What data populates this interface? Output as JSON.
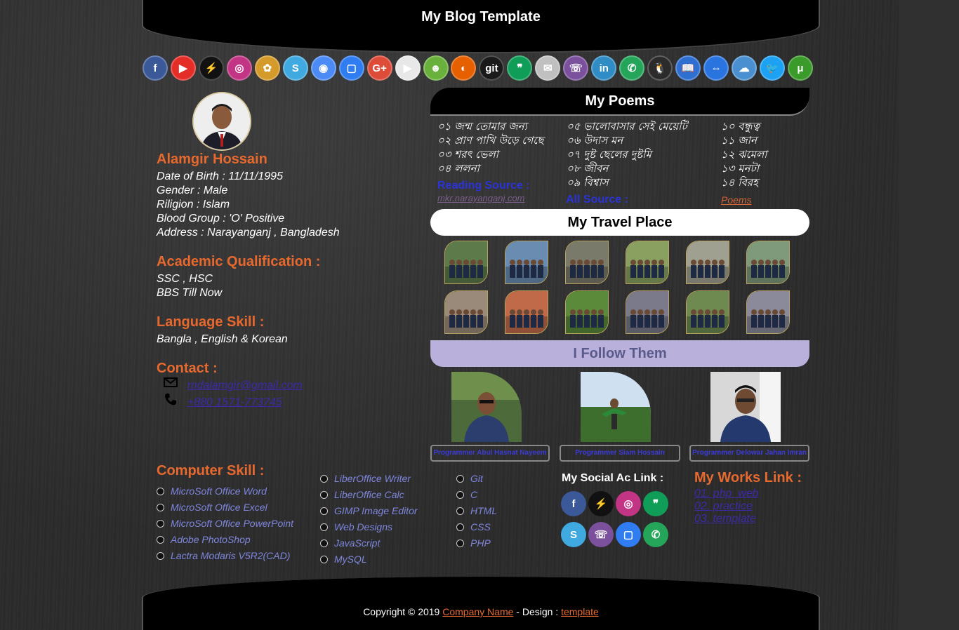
{
  "header": {
    "title": "My Blog Template"
  },
  "iconbar": [
    {
      "name": "facebook-icon",
      "glyph": "f",
      "color": "#3b5998"
    },
    {
      "name": "youtube-icon",
      "glyph": "▶",
      "color": "#e52d27"
    },
    {
      "name": "messenger-icon",
      "glyph": "⚡",
      "color": "#111111"
    },
    {
      "name": "instagram-icon",
      "glyph": "◎",
      "color": "#c13584"
    },
    {
      "name": "picasa-icon",
      "glyph": "✿",
      "color": "#d49a2a"
    },
    {
      "name": "skype-icon",
      "glyph": "S",
      "color": "#3fa9e0"
    },
    {
      "name": "chrome-icon",
      "glyph": "◉",
      "color": "#4c8bf5"
    },
    {
      "name": "duo-icon",
      "glyph": "▢",
      "color": "#2f7df0"
    },
    {
      "name": "google-plus-icon",
      "glyph": "G+",
      "color": "#dd4b39"
    },
    {
      "name": "play-store-icon",
      "glyph": "▶",
      "color": "#e8e8e8"
    },
    {
      "name": "duolingo-icon",
      "glyph": "☻",
      "color": "#6ab03c"
    },
    {
      "name": "firefox-icon",
      "glyph": "◐",
      "color": "#e66000"
    },
    {
      "name": "git-icon",
      "glyph": "git",
      "color": "#1a1a1a"
    },
    {
      "name": "hangouts-icon",
      "glyph": "❞",
      "color": "#0f9d58"
    },
    {
      "name": "gmail-icon",
      "glyph": "✉",
      "color": "#c0c0c0"
    },
    {
      "name": "viber-icon",
      "glyph": "☏",
      "color": "#7b519d"
    },
    {
      "name": "linkedin-icon",
      "glyph": "in",
      "color": "#2f8cc4"
    },
    {
      "name": "whatsapp-icon",
      "glyph": "✆",
      "color": "#25a55a"
    },
    {
      "name": "linux-icon",
      "glyph": "🐧",
      "color": "#2b2b2b"
    },
    {
      "name": "book-icon",
      "glyph": "📖",
      "color": "#2f6fd0"
    },
    {
      "name": "teamviewer-icon",
      "glyph": "⇔",
      "color": "#2a74e0"
    },
    {
      "name": "cloud-icon",
      "glyph": "☁",
      "color": "#4a90d0"
    },
    {
      "name": "twitter-icon",
      "glyph": "🐦",
      "color": "#1da1f2"
    },
    {
      "name": "utorrent-icon",
      "glyph": "μ",
      "color": "#3a9a2a"
    }
  ],
  "profile": {
    "name": "Alamgir Hossain",
    "dob": "Date of Birth : 11/11/1995",
    "gender": "Gender : Male",
    "religion": "Riligion : Islam",
    "blood": "Blood Group : 'O' Positive",
    "address": "Address : Narayanganj , Bangladesh"
  },
  "academic": {
    "title": "Academic Qualification :",
    "line1": "SSC , HSC",
    "line2": "BBS Till Now"
  },
  "language": {
    "title": "Language Skill :",
    "line1": "Bangla , English & Korean"
  },
  "contact": {
    "title": "Contact :",
    "email": "mdalamgir@gmail.com",
    "phone": "+880 1571-773745"
  },
  "poems": {
    "title": "My Poems",
    "col1": [
      "০১ জন্ম তোমার জন্য",
      "০২ প্রাণ পাখি উড়ে গেছে",
      "০৩ শরৎ ভেলা",
      "০৪ ললনা"
    ],
    "col2": [
      "০৫ ভালোবাসার সেই মেয়েটি",
      "০৬ উদাস মন",
      "০৭ দুষ্ট ছেলের দুষ্টমি",
      "০৮ জীবন",
      "০৯ বিশ্বাস"
    ],
    "col3": [
      "১০ বন্ধুত্ব",
      "১১ জান",
      "১২ ঝমেলা",
      "১৩ মনটা",
      "১৪ বিরহ"
    ],
    "reading_label": "Reading Source :",
    "reading_link": "mkr.narayanganj.com",
    "all_label": "All Source :",
    "all_link": "Poems"
  },
  "travel": {
    "title": "My Travel Place"
  },
  "follow": {
    "title": "I Follow Them",
    "people": [
      {
        "caption": "Programmer Abul Hasnat Nayeem"
      },
      {
        "caption": "Programmer Siam Hossain"
      },
      {
        "caption": "Programmer Delowar Jahan Imran"
      }
    ]
  },
  "computer_skill": {
    "title": "Computer Skill :",
    "col1": [
      "MicroSoft Office Word",
      "MicroSoft Office Excel",
      "MicroSoft Office PowerPoint",
      "Adobe PhotoShop",
      "Lactra Modaris V5R2(CAD)"
    ],
    "col2": [
      "LiberOffice Writer",
      "LiberOffice Calc",
      "GIMP Image Editor",
      "Web Designs",
      "JavaScript",
      "MySQL"
    ],
    "col3": [
      "Git",
      "C",
      "HTML",
      "CSS",
      "PHP"
    ]
  },
  "social": {
    "title": "My Social Ac Link :",
    "icons": [
      {
        "name": "facebook-icon",
        "glyph": "f",
        "color": "#3b5998"
      },
      {
        "name": "messenger-icon",
        "glyph": "⚡",
        "color": "#111111"
      },
      {
        "name": "instagram-icon",
        "glyph": "◎",
        "color": "#c13584"
      },
      {
        "name": "hangouts-icon",
        "glyph": "❞",
        "color": "#0f9d58"
      },
      {
        "name": "skype-icon",
        "glyph": "S",
        "color": "#3fa9e0"
      },
      {
        "name": "viber-icon",
        "glyph": "☏",
        "color": "#7b519d"
      },
      {
        "name": "duo-icon",
        "glyph": "▢",
        "color": "#2f7df0"
      },
      {
        "name": "whatsapp-icon",
        "glyph": "✆",
        "color": "#25a55a"
      }
    ]
  },
  "works": {
    "title": "My Works Link :",
    "links": [
      "01. php_web",
      "02. practice",
      "03. template"
    ]
  },
  "footer": {
    "prefix": "Copyright © 2019 ",
    "company": "Company Name",
    "middle": " - Design : ",
    "design": "template"
  },
  "colors": {
    "accent": "#e8692e",
    "link": "#3b2aa8",
    "source": "#2a33d6",
    "lavender": "#b9b0dc"
  }
}
